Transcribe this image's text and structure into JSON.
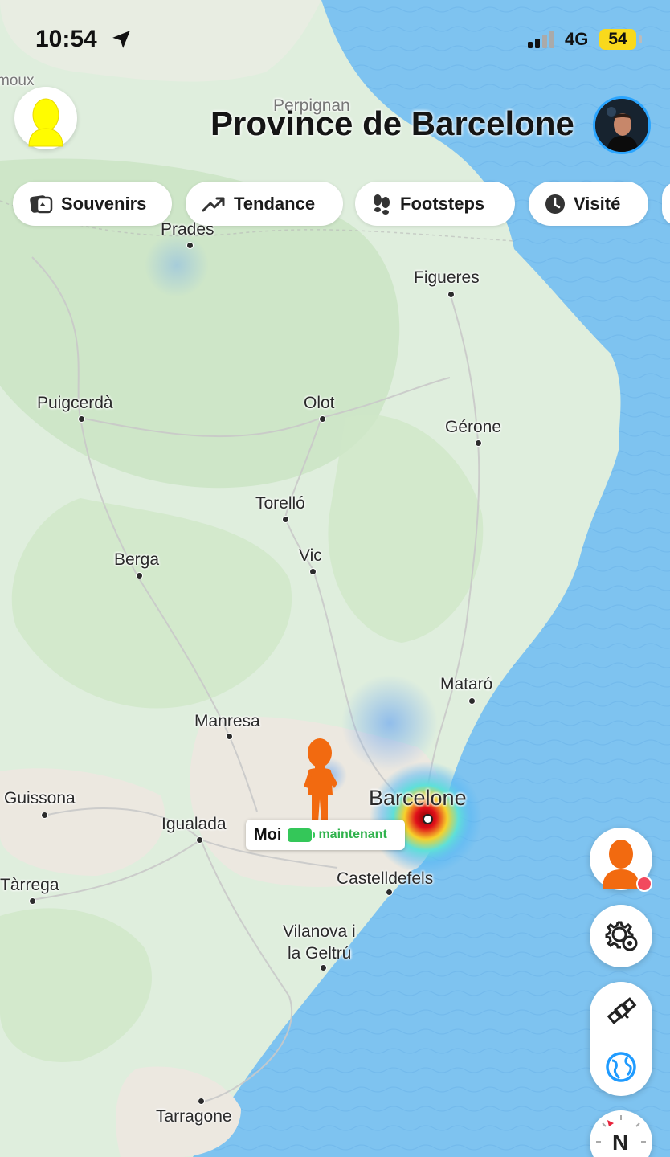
{
  "status_bar": {
    "time": "10:54",
    "network": "4G",
    "battery": "54"
  },
  "header": {
    "title": "Province de Barcelone"
  },
  "filters": [
    {
      "label": "Souvenirs",
      "icon": "memories-icon"
    },
    {
      "label": "Tendance",
      "icon": "trending-icon"
    },
    {
      "label": "Footsteps",
      "icon": "footsteps-icon"
    },
    {
      "label": "Visité",
      "icon": "clock-icon"
    }
  ],
  "map": {
    "places": [
      {
        "name": "moux"
      },
      {
        "name": "Perpignan"
      },
      {
        "name": "Prades"
      },
      {
        "name": "Figueres"
      },
      {
        "name": "Puigcerdà"
      },
      {
        "name": "Olot"
      },
      {
        "name": "Gérone"
      },
      {
        "name": "Torelló"
      },
      {
        "name": "Vic"
      },
      {
        "name": "Berga"
      },
      {
        "name": "Mataró"
      },
      {
        "name": "Manresa"
      },
      {
        "name": "Barcelone"
      },
      {
        "name": "Guissona"
      },
      {
        "name": "Igualada"
      },
      {
        "name": "Castelldefels"
      },
      {
        "name": "Tàrrega"
      },
      {
        "name": "Vilanova i"
      },
      {
        "name": "la Geltrú"
      },
      {
        "name": "Tarragone"
      }
    ]
  },
  "user_marker": {
    "name": "Moi",
    "time": "maintenant"
  },
  "compass": {
    "label": "N"
  },
  "colors": {
    "sea": "#7ec3f0",
    "land": "#dfeedd",
    "accent_blue": "#1f9bff",
    "bitmoji_orange": "#f26a10",
    "ghost_yellow": "#fffc00"
  }
}
